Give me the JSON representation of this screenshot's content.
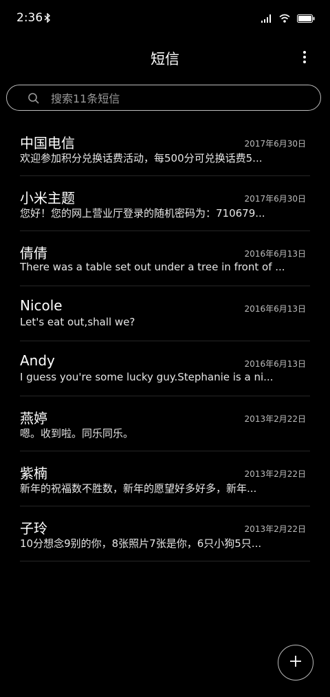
{
  "status_bar": {
    "time": "2:36"
  },
  "header": {
    "title": "短信"
  },
  "search": {
    "placeholder": "搜索11条短信"
  },
  "conversations": [
    {
      "name": "中国电信",
      "date": "2017年6月30日",
      "preview": "欢迎参加积分兑换话费活动，每500分可兑换话费5..."
    },
    {
      "name": "小米主题",
      "date": "2017年6月30日",
      "preview": "您好！您的网上营业厅登录的随机密码为：710679..."
    },
    {
      "name": "倩倩",
      "date": "2016年6月13日",
      "preview": "There was a table set out under a tree in front of ..."
    },
    {
      "name": "Nicole",
      "date": "2016年6月13日",
      "preview": "Let's eat out,shall we?"
    },
    {
      "name": "Andy",
      "date": "2016年6月13日",
      "preview": "I guess you're some lucky guy.Stephanie is a ni..."
    },
    {
      "name": "燕婷",
      "date": "2013年2月22日",
      "preview": "嗯。收到啦。同乐同乐。"
    },
    {
      "name": "紫楠",
      "date": "2013年2月22日",
      "preview": "新年的祝福数不胜数，新年的愿望好多好多，新年..."
    },
    {
      "name": "子玲",
      "date": "2013年2月22日",
      "preview": "10分想念9别的你，8张照片7张是你，6只小狗5只..."
    }
  ],
  "icons": {
    "bluetooth": "bluetooth-icon",
    "signal": "signal-icon",
    "wifi": "wifi-icon",
    "battery": "battery-icon",
    "more": "more-vertical-icon",
    "search": "search-icon",
    "compose": "plus-icon"
  }
}
